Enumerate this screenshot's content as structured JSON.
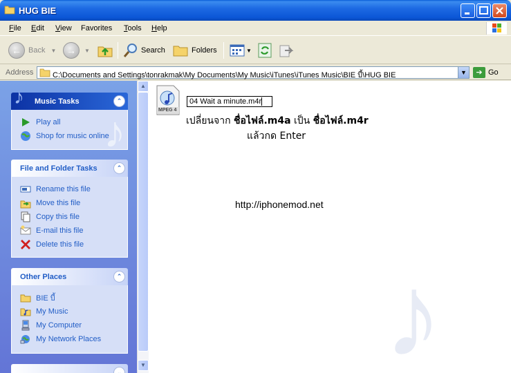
{
  "window": {
    "title": "HUG BIE"
  },
  "menu": [
    {
      "key": "F",
      "rest": "ile"
    },
    {
      "key": "E",
      "rest": "dit"
    },
    {
      "key": "V",
      "rest": "iew"
    },
    {
      "key": "F",
      "rest": "avorites",
      "pre": ""
    },
    {
      "key": "T",
      "rest": "ools"
    },
    {
      "key": "H",
      "rest": "elp"
    }
  ],
  "toolbar": {
    "back_label": "Back",
    "search_label": "Search",
    "folders_label": "Folders"
  },
  "address": {
    "label": "Address",
    "path": "C:\\Documents and Settings\\tonrakmak\\My Documents\\My Music\\iTunes\\iTunes Music\\BIE บี้\\HUG BIE",
    "go_label": "Go"
  },
  "panels": {
    "music": {
      "title": "Music Tasks",
      "items": [
        "Play all",
        "Shop for music online"
      ]
    },
    "file": {
      "title": "File and Folder Tasks",
      "items": [
        "Rename this file",
        "Move this file",
        "Copy this file",
        "E-mail this file",
        "Delete this file"
      ]
    },
    "places": {
      "title": "Other Places",
      "items": [
        "BIE บี้",
        "My Music",
        "My Computer",
        "My Network Places"
      ]
    }
  },
  "content": {
    "file_icon_label": "MPEG 4",
    "rename_value": "04 Wait a minute.m4r",
    "instruction_prefix": "เปลี่ยนจาก ",
    "instruction_from": "ชื่อไฟล์.m4a",
    "instruction_mid": " เป็น ",
    "instruction_to": "ชื่อไฟล์.m4r",
    "instruction_line2": "แล้วกด Enter",
    "url": "http://iphonemod.net"
  },
  "colors": {
    "title_bar": "#0b56d6",
    "task_pane": "#6f8fe0",
    "link": "#215dc6"
  }
}
